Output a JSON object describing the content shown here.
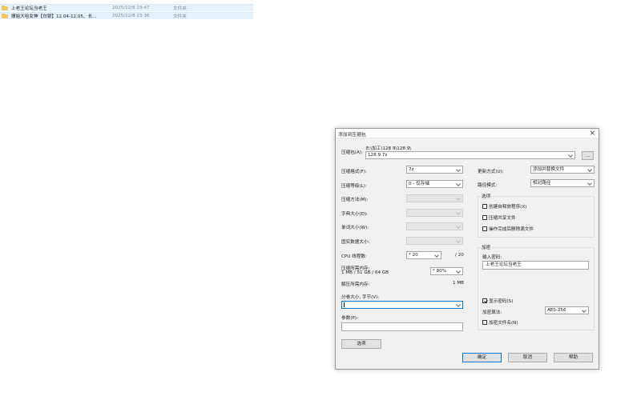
{
  "file_list": [
    {
      "name": "上老王论坛当老王",
      "date": "2025/12/8 23:47",
      "type": "文件夹"
    },
    {
      "name": "姗姐大哈女神【白银】12.04-12.05、长...",
      "date": "2025/12/8 23:36",
      "type": "文件夹"
    }
  ],
  "dialog": {
    "title": "添加到压缩包",
    "archive": {
      "label": "压缩包(A):",
      "path": "E:\\加工\\128 9\\128 9\\",
      "value": "128 9.7z",
      "browse_label": "..."
    },
    "left": {
      "format": {
        "label": "压缩格式(F):",
        "value": "7z"
      },
      "level": {
        "label": "压缩等级(L):",
        "value": "0 - 仅存储"
      },
      "method": {
        "label": "压缩方法(M):",
        "value": ""
      },
      "dict": {
        "label": "字典大小(D):",
        "value": ""
      },
      "word": {
        "label": "单词大小(W):",
        "value": ""
      },
      "solid": {
        "label": "固实数据大小:",
        "value": ""
      },
      "cpu": {
        "label": "CPU 线程数:",
        "value": "* 20",
        "max": "/ 20"
      },
      "mem_compress": {
        "label": "压缩所需内存:",
        "detail": "1 MB / 51 GB / 64 GB",
        "value": "* 80%"
      },
      "mem_decompress": {
        "label": "解压所需内存:",
        "value": "1 MB"
      },
      "volume": {
        "label": "分卷大小, 字节(V):",
        "value": ""
      },
      "params": {
        "label": "参数(P):",
        "value": ""
      },
      "options_button": "选项"
    },
    "right": {
      "update": {
        "label": "更新方式(U):",
        "value": "添加并替换文件"
      },
      "path_mode": {
        "label": "路径模式:",
        "value": "相对路径"
      },
      "options_group": {
        "title": "选项",
        "sfx": {
          "label": "创建自释放程序(X)",
          "checked": false
        },
        "shared": {
          "label": "压缩共享文件",
          "checked": false
        },
        "delete": {
          "label": "操作完成后删除源文件",
          "checked": false
        }
      },
      "encryption": {
        "title": "加密",
        "password_label": "输入密码:",
        "password_value": "上老王论坛当老王",
        "show_password": {
          "label": "显示密码(S)",
          "checked": true
        },
        "method_label": "加密算法:",
        "method_value": "AES-256",
        "encrypt_names": {
          "label": "加密文件名(N)",
          "checked": false
        }
      }
    },
    "buttons": {
      "ok": "确定",
      "cancel": "取消",
      "help": "帮助"
    }
  }
}
